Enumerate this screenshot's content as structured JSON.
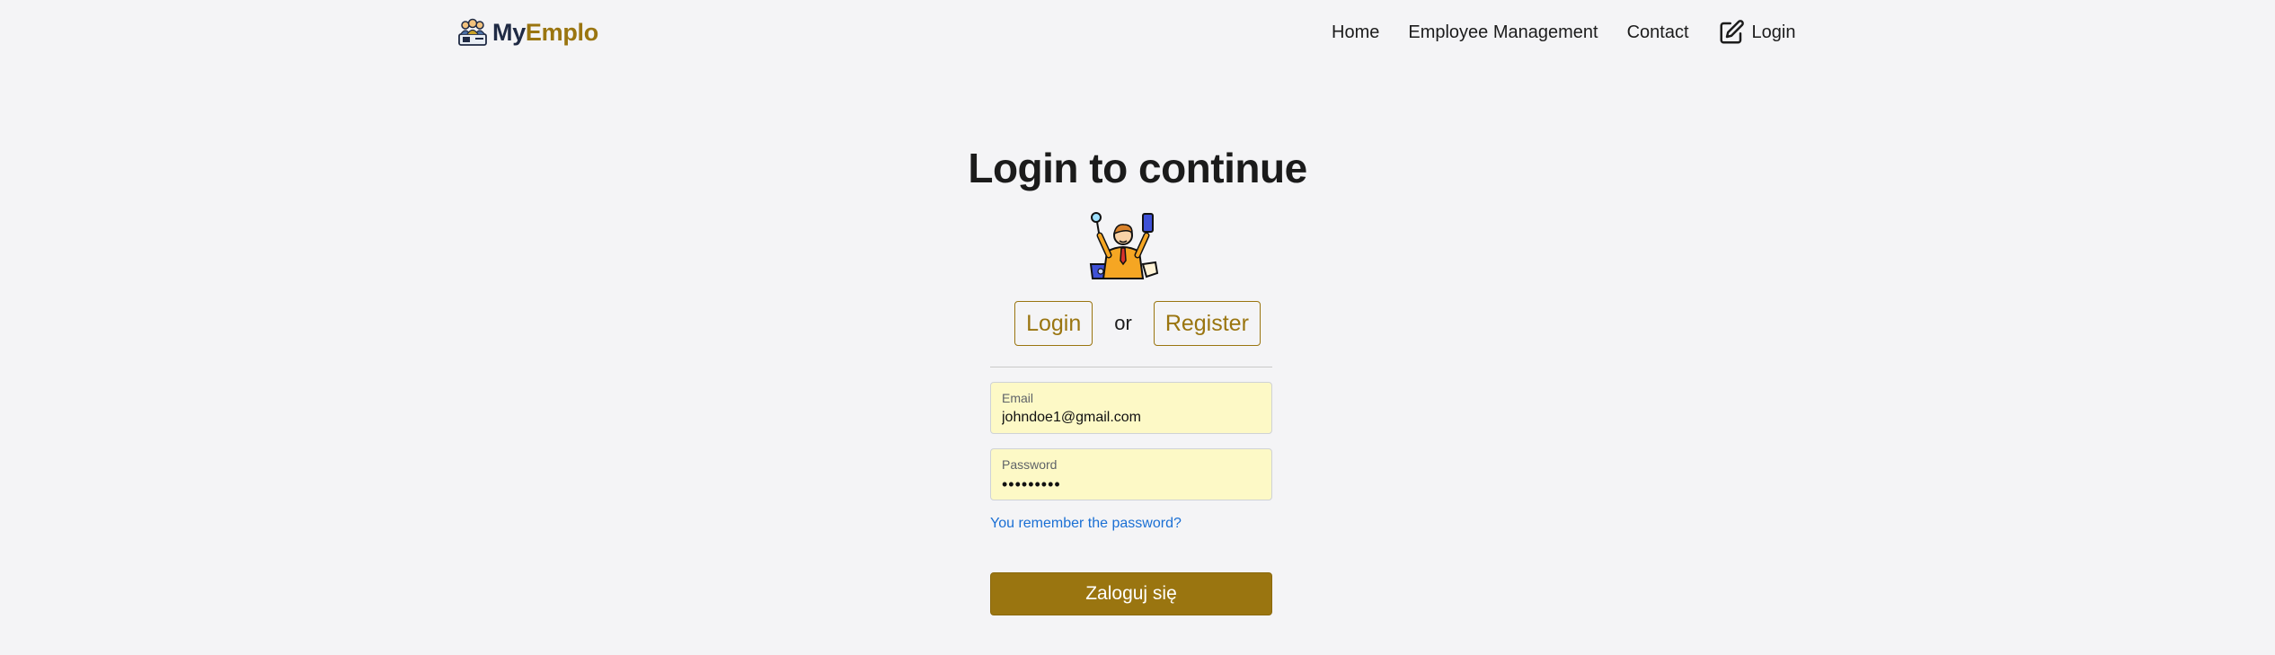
{
  "brand": {
    "logo_icon": "team-logo-icon",
    "name_part1": "My",
    "name_part2": "Emplo",
    "color_primary": "#1f2a44",
    "color_accent": "#9a7510"
  },
  "nav": {
    "items": [
      {
        "label": "Home"
      },
      {
        "label": "Employee Management"
      },
      {
        "label": "Contact"
      }
    ],
    "login": {
      "label": "Login",
      "icon": "edit-square-icon"
    }
  },
  "main": {
    "title": "Login to continue",
    "hero_icon": "multitasking-employee-illustration",
    "switch": {
      "login_label": "Login",
      "separator": "or",
      "register_label": "Register"
    },
    "form": {
      "email": {
        "label": "Email",
        "value": "johndoe1@gmail.com"
      },
      "password": {
        "label": "Password",
        "value": "•••••••••"
      },
      "forgot_link": "You remember the password?",
      "submit_label": "Zaloguj się"
    }
  },
  "colors": {
    "accent": "#9a7510",
    "field_background": "#fdf9c6",
    "link": "#1a6fd4",
    "page_background": "#f4f4f6"
  }
}
